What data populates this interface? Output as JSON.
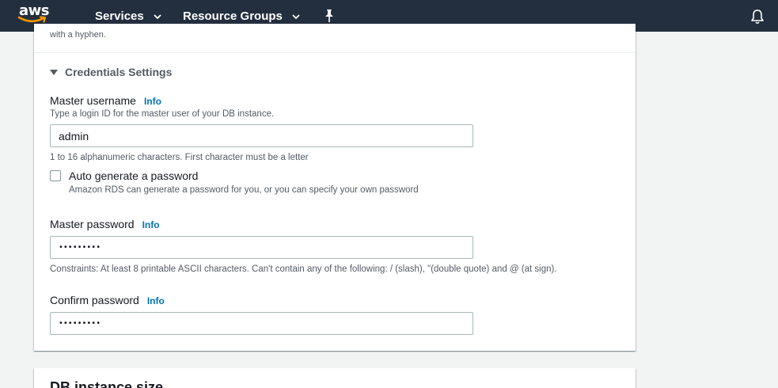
{
  "nav": {
    "logo_text": "aws",
    "services_label": "Services",
    "resource_groups_label": "Resource Groups"
  },
  "colors": {
    "nav_bg": "#232f3e",
    "logo_smile": "#ff9900",
    "link": "#0073bb",
    "page_bg": "#f2f3f3"
  },
  "icons": [
    "chevron-down-icon",
    "pin-icon",
    "bell-icon",
    "caret-down-icon",
    "checkbox-icon"
  ],
  "previous_hint": "with a hyphen.",
  "credentials": {
    "title": "Credentials Settings",
    "master_username": {
      "label": "Master username",
      "info": "Info",
      "description": "Type a login ID for the master user of your DB instance.",
      "value": "admin",
      "constraint": "1 to 16 alphanumeric characters. First character must be a letter"
    },
    "auto_generate": {
      "label": "Auto generate a password",
      "description": "Amazon RDS can generate a password for you, or you can specify your own password",
      "checked": false
    },
    "master_password": {
      "label": "Master password",
      "info": "Info",
      "masked_value": "•••••••••",
      "constraint": "Constraints: At least 8 printable ASCII characters. Can't contain any of the following: / (slash), \"(double quote) and @ (at sign)."
    },
    "confirm_password": {
      "label": "Confirm password",
      "info": "Info",
      "masked_value": "•••••••••"
    }
  },
  "next_section": {
    "title": "DB instance size"
  }
}
